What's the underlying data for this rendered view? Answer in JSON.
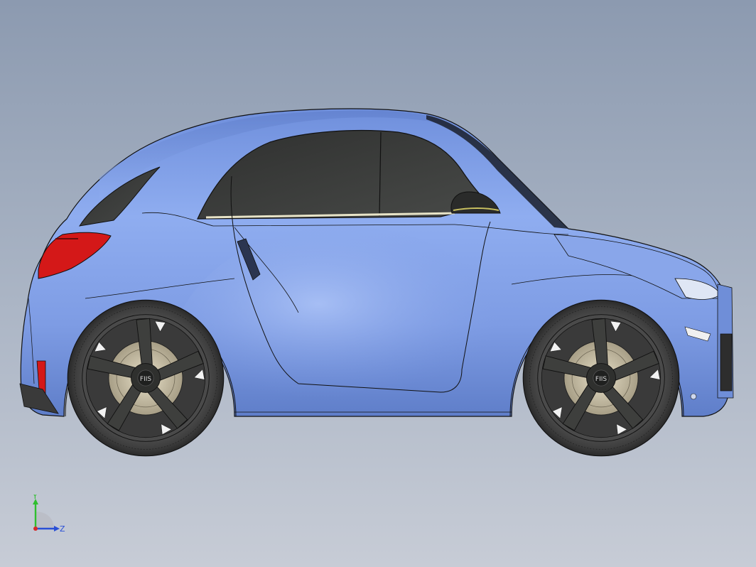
{
  "viewport": {
    "background_top": "#8c9ab0",
    "background_bottom": "#c7ccd6"
  },
  "model": {
    "body_color": "#7f9ee6",
    "window_color": "#3a3c3a",
    "tail_light_color": "#d41818",
    "wheel_badge": "FIIS"
  },
  "triad": {
    "y_label": "Y",
    "z_label": "Z",
    "y_color": "#2fbf2f",
    "z_color": "#2a4fd6",
    "x_color": "#d62a2a"
  }
}
